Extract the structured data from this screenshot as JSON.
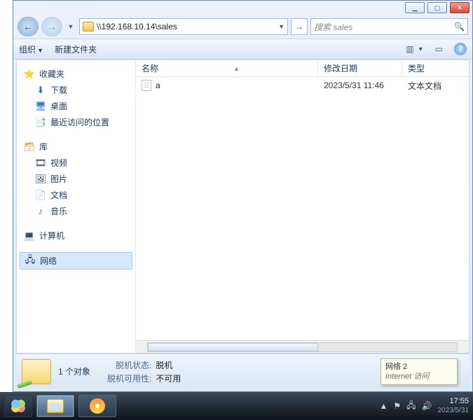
{
  "window": {
    "min": "▁",
    "max": "▢",
    "close": "✕"
  },
  "addr": {
    "path": "\\\\192.168.10.14\\sales"
  },
  "search": {
    "placeholder": "搜索 sales"
  },
  "toolbar": {
    "organize": "组织",
    "newfolder": "新建文件夹"
  },
  "nav": {
    "favorites": "收藏夹",
    "downloads": "下载",
    "desktop": "桌面",
    "recent": "最近访问的位置",
    "libraries": "库",
    "videos": "视频",
    "pictures": "图片",
    "documents": "文档",
    "music": "音乐",
    "computer": "计算机",
    "network": "网络"
  },
  "cols": {
    "name": "名称",
    "date": "修改日期",
    "type": "类型"
  },
  "rows": [
    {
      "name": "a",
      "date": "2023/5/31 11:46",
      "type": "文本文档"
    }
  ],
  "details": {
    "count": "1 个对象",
    "offline_k": "脱机状态:",
    "offline_v": "脱机",
    "avail_k": "脱机可用性:",
    "avail_v": "不可用"
  },
  "tooltip": {
    "line1": "网络 2",
    "line2": "Internet 访问"
  },
  "clock": {
    "time": "17:55",
    "date": "2023/5/31",
    "date2": "2023/5/31"
  }
}
